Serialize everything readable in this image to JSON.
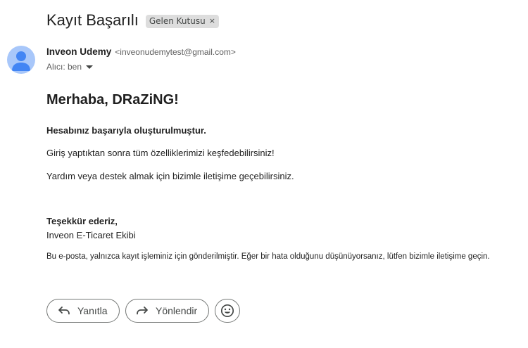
{
  "email": {
    "subject": "Kayıt Başarılı",
    "label": "Gelen Kutusu",
    "label_remove": "×",
    "sender_name": "Inveon Udemy",
    "sender_email": "<inveonudemytest@gmail.com>",
    "recipient": "Alıcı: ben",
    "avatar_color": "#a8c7fa"
  },
  "body": {
    "greeting": "Merhaba, DRaZiNG!",
    "line1": "Hesabınız başarıyla oluşturulmuştur.",
    "line2": "Giriş yaptıktan sonra tüm özelliklerimizi keşfedebilirsiniz!",
    "line3": "Yardım veya destek almak için bizimle iletişime geçebilirsiniz.",
    "thanks": "Teşekkür ederiz,",
    "team": "Inveon E-Ticaret Ekibi",
    "disclaimer": "Bu e-posta, yalnızca kayıt işleminiz için gönderilmiştir. Eğer bir hata olduğunu düşünüyorsanız, lütfen bizimle iletişime geçin."
  },
  "actions": {
    "reply_label": "Yanıtla",
    "reply_icon": "reply-icon",
    "forward_label": "Yönlendir",
    "forward_icon": "forward-icon",
    "emoji_icon": "emoji-icon"
  }
}
